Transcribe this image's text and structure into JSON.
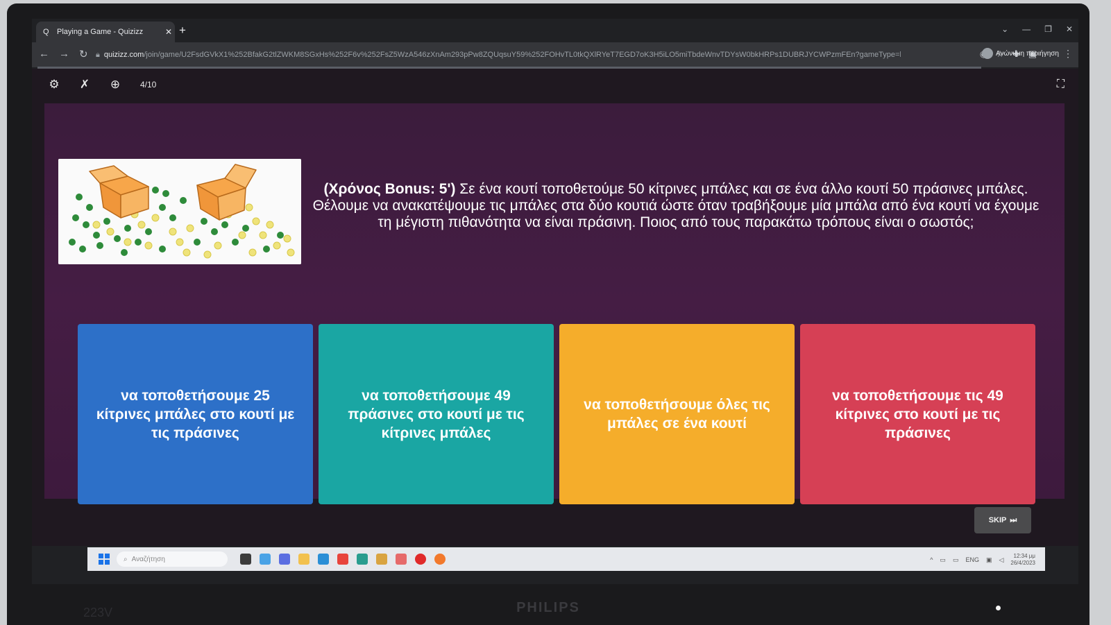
{
  "browser": {
    "tab_title": "Playing a Game - Quizizz",
    "url_host": "quizizz.com",
    "url_path": "/join/game/U2FsdGVkX1%252BfakG2tlZWKM8SGxHs%252F6v%252FsZ5WzA546zXnAm293pPw8ZQUqsuY59%252FOHvTL0tkQXlRYeT7EGD7oK3H5iLO5miTbdeWnvTDYsW0bkHRPs1DUBRJYCWPzmFEn?gameType=live",
    "profile_label": "Ανώνυμη περιήγηση"
  },
  "game": {
    "question_counter": "4/10",
    "question_bonus": "(Χρόνος Bonus: 5')",
    "question_text": "Σε ένα κουτί τοποθετούμε 50 κίτρινες μπάλες και σε ένα άλλο κουτί 50 πράσινες μπάλες. Θέλουμε να ανακατέψουμε τις μπάλες στα δύο κουτιά ώστε όταν τραβήξουμε μία μπάλα από ένα κουτί να έχουμε τη μέγιστη πιθανότητα να είναι πράσινη. Ποιος από τους παρακάτω τρόπους είναι ο σωστός;",
    "answers": [
      {
        "label": "να τοποθετήσουμε 25 κίτρινες μπάλες στο κουτί με τις πράσινες",
        "color": "#2d70c8"
      },
      {
        "label": "να τοποθετήσουμε 49 πράσινες στο κουτί με τις κίτρινες μπάλες",
        "color": "#1aa6a3"
      },
      {
        "label": "να τοποθετήσουμε όλες τις μπάλες σε ένα κουτί",
        "color": "#f5ad2b"
      },
      {
        "label": "να τοποθετήσουμε τις 49 κίτρινες στο κουτί με τις πράσινες",
        "color": "#d64055"
      }
    ],
    "skip_label": "SKIP"
  },
  "taskbar": {
    "search_placeholder": "Αναζήτηση",
    "language": "ENG",
    "time": "12:34 μμ",
    "date": "26/4/2023"
  },
  "monitor": {
    "brand": "PHILIPS",
    "model": "223V"
  }
}
